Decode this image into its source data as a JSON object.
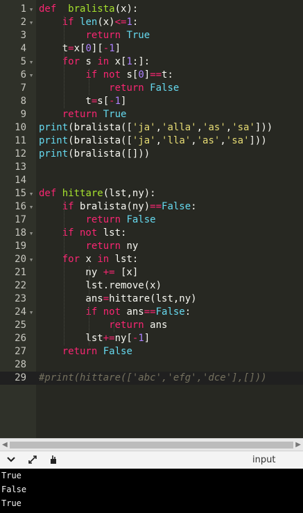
{
  "editor": {
    "lines": [
      {
        "n": "1",
        "fold": "▾",
        "segs": [
          [
            "kw",
            "def"
          ],
          [
            "",
            "  "
          ],
          [
            "fn",
            "bralista"
          ],
          [
            "",
            "(x):"
          ]
        ]
      },
      {
        "n": "2",
        "fold": "▾",
        "segs": [
          [
            "",
            "    "
          ],
          [
            "kw",
            "if"
          ],
          [
            "",
            " "
          ],
          [
            "bi",
            "len"
          ],
          [
            "",
            "(x)"
          ],
          [
            "kw",
            "<="
          ],
          [
            "num",
            "1"
          ],
          [
            "",
            ":"
          ]
        ]
      },
      {
        "n": "3",
        "segs": [
          [
            "",
            "        "
          ],
          [
            "kw",
            "return"
          ],
          [
            "",
            " "
          ],
          [
            "bi",
            "True"
          ]
        ]
      },
      {
        "n": "4",
        "segs": [
          [
            "",
            "    t"
          ],
          [
            "kw",
            "="
          ],
          [
            "",
            "x["
          ],
          [
            "num",
            "0"
          ],
          [
            "",
            "]["
          ],
          [
            "kw",
            "-"
          ],
          [
            "num",
            "1"
          ],
          [
            "",
            "]"
          ]
        ]
      },
      {
        "n": "5",
        "fold": "▾",
        "segs": [
          [
            "",
            "    "
          ],
          [
            "kw",
            "for"
          ],
          [
            "",
            " s "
          ],
          [
            "kw",
            "in"
          ],
          [
            "",
            " x["
          ],
          [
            "num",
            "1"
          ],
          [
            "",
            ":]:"
          ]
        ]
      },
      {
        "n": "6",
        "fold": "▾",
        "segs": [
          [
            "",
            "        "
          ],
          [
            "kw",
            "if not"
          ],
          [
            "",
            " s["
          ],
          [
            "num",
            "0"
          ],
          [
            "",
            "]"
          ],
          [
            "kw",
            "=="
          ],
          [
            "",
            "t:"
          ]
        ]
      },
      {
        "n": "7",
        "segs": [
          [
            "",
            "            "
          ],
          [
            "kw",
            "return"
          ],
          [
            "",
            " "
          ],
          [
            "bi",
            "False"
          ]
        ]
      },
      {
        "n": "8",
        "segs": [
          [
            "",
            "        t"
          ],
          [
            "kw",
            "="
          ],
          [
            "",
            "s["
          ],
          [
            "kw",
            "-"
          ],
          [
            "num",
            "1"
          ],
          [
            "",
            "]"
          ]
        ]
      },
      {
        "n": "9",
        "segs": [
          [
            "",
            "    "
          ],
          [
            "kw",
            "return"
          ],
          [
            "",
            " "
          ],
          [
            "bi",
            "True"
          ]
        ]
      },
      {
        "n": "10",
        "segs": [
          [
            "bi",
            "print"
          ],
          [
            "",
            "(bralista(["
          ],
          [
            "str",
            "'ja'"
          ],
          [
            "",
            ","
          ],
          [
            "str",
            "'alla'"
          ],
          [
            "",
            ","
          ],
          [
            "str",
            "'as'"
          ],
          [
            "",
            ","
          ],
          [
            "str",
            "'sa'"
          ],
          [
            "",
            "]))"
          ]
        ]
      },
      {
        "n": "11",
        "segs": [
          [
            "bi",
            "print"
          ],
          [
            "",
            "(bralista(["
          ],
          [
            "str",
            "'ja'"
          ],
          [
            "",
            ","
          ],
          [
            "str",
            "'lla'"
          ],
          [
            "",
            ","
          ],
          [
            "str",
            "'as'"
          ],
          [
            "",
            ","
          ],
          [
            "str",
            "'sa'"
          ],
          [
            "",
            "]))"
          ]
        ]
      },
      {
        "n": "12",
        "segs": [
          [
            "bi",
            "print"
          ],
          [
            "",
            "(bralista([]))"
          ]
        ]
      },
      {
        "n": "13",
        "segs": []
      },
      {
        "n": "14",
        "segs": []
      },
      {
        "n": "15",
        "fold": "▾",
        "segs": [
          [
            "kw",
            "def"
          ],
          [
            "",
            " "
          ],
          [
            "fn",
            "hittare"
          ],
          [
            "",
            "(lst,ny):"
          ]
        ]
      },
      {
        "n": "16",
        "fold": "▾",
        "segs": [
          [
            "",
            "    "
          ],
          [
            "kw",
            "if"
          ],
          [
            "",
            " bralista(ny)"
          ],
          [
            "kw",
            "=="
          ],
          [
            "bi",
            "False"
          ],
          [
            "",
            ":"
          ]
        ]
      },
      {
        "n": "17",
        "segs": [
          [
            "",
            "        "
          ],
          [
            "kw",
            "return"
          ],
          [
            "",
            " "
          ],
          [
            "bi",
            "False"
          ]
        ]
      },
      {
        "n": "18",
        "fold": "▾",
        "segs": [
          [
            "",
            "    "
          ],
          [
            "kw",
            "if not"
          ],
          [
            "",
            " lst:"
          ]
        ]
      },
      {
        "n": "19",
        "segs": [
          [
            "",
            "        "
          ],
          [
            "kw",
            "return"
          ],
          [
            "",
            " ny"
          ]
        ]
      },
      {
        "n": "20",
        "fold": "▾",
        "segs": [
          [
            "",
            "    "
          ],
          [
            "kw",
            "for"
          ],
          [
            "",
            " x "
          ],
          [
            "kw",
            "in"
          ],
          [
            "",
            " lst:"
          ]
        ]
      },
      {
        "n": "21",
        "segs": [
          [
            "",
            "        ny "
          ],
          [
            "kw",
            "+="
          ],
          [
            "",
            " [x]"
          ]
        ]
      },
      {
        "n": "22",
        "segs": [
          [
            "",
            "        lst.remove(x)"
          ]
        ]
      },
      {
        "n": "23",
        "segs": [
          [
            "",
            "        ans"
          ],
          [
            "kw",
            "="
          ],
          [
            "",
            "hittare(lst,ny)"
          ]
        ]
      },
      {
        "n": "24",
        "fold": "▾",
        "segs": [
          [
            "",
            "        "
          ],
          [
            "kw",
            "if not"
          ],
          [
            "",
            " ans"
          ],
          [
            "kw",
            "=="
          ],
          [
            "bi",
            "False"
          ],
          [
            "",
            ":"
          ]
        ]
      },
      {
        "n": "25",
        "segs": [
          [
            "",
            "            "
          ],
          [
            "kw",
            "return"
          ],
          [
            "",
            " ans"
          ]
        ]
      },
      {
        "n": "26",
        "segs": [
          [
            "",
            "        lst"
          ],
          [
            "kw",
            "+="
          ],
          [
            "",
            "ny["
          ],
          [
            "kw",
            "-"
          ],
          [
            "num",
            "1"
          ],
          [
            "",
            "]"
          ]
        ]
      },
      {
        "n": "27",
        "segs": [
          [
            "",
            "    "
          ],
          [
            "kw",
            "return"
          ],
          [
            "",
            " "
          ],
          [
            "bi",
            "False"
          ]
        ]
      },
      {
        "n": "28",
        "segs": []
      },
      {
        "n": "29",
        "segs": [
          [
            "cmt",
            "#print(hittare(['abc','efg','dce'],[]))"
          ]
        ]
      }
    ],
    "active_line": 29
  },
  "toolbar": {
    "input_label": "input",
    "icons": [
      "chevron-down-icon",
      "expand-icon",
      "clear-console-icon"
    ]
  },
  "console": {
    "output": [
      "True",
      "False",
      "True"
    ]
  },
  "colors": {
    "background": "#272822",
    "keyword": "#f92672",
    "builtin": "#66d9ef",
    "function": "#a6e22e",
    "number": "#ae81ff",
    "string": "#e6db74",
    "comment": "#75715e"
  }
}
